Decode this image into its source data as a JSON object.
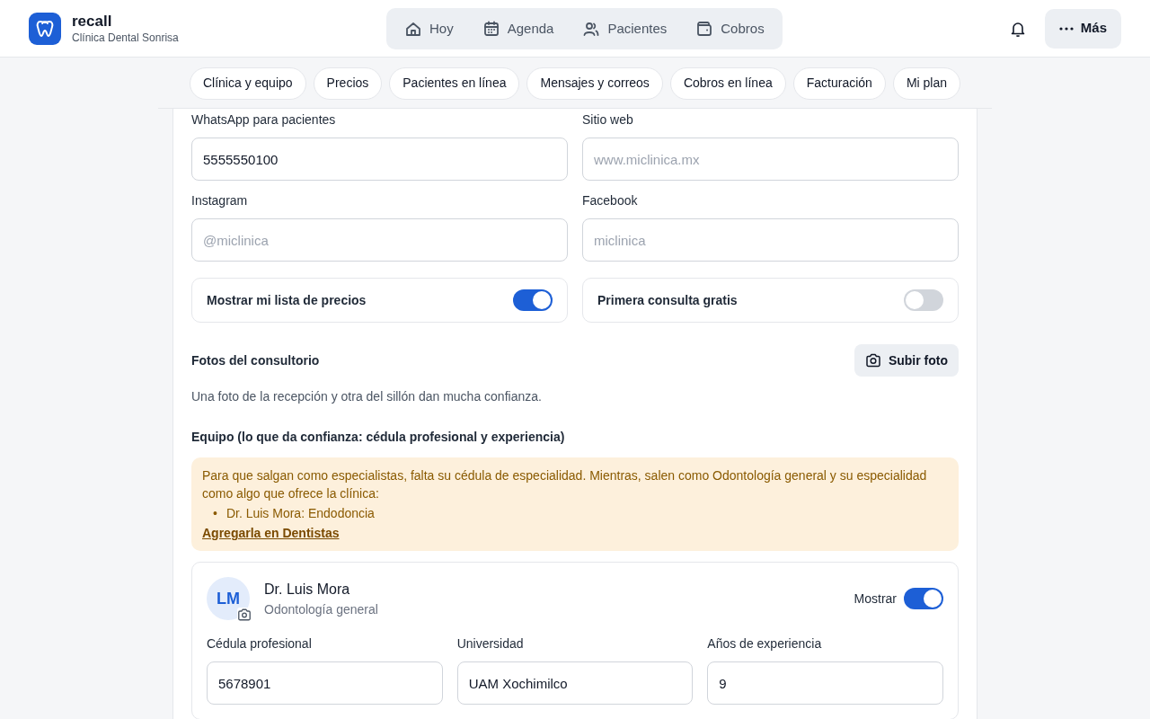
{
  "app": {
    "name": "recall",
    "clinic": "Clínica Dental Sonrisa"
  },
  "nav": [
    {
      "label": "Hoy",
      "selected": false
    },
    {
      "label": "Agenda",
      "selected": false
    },
    {
      "label": "Pacientes",
      "selected": false
    },
    {
      "label": "Cobros",
      "selected": false
    }
  ],
  "more_button": "Más",
  "settings_tabs": [
    {
      "label": "Clínica y equipo",
      "selected": false
    },
    {
      "label": "Precios",
      "selected": false
    },
    {
      "label": "Pacientes en línea",
      "selected": false
    },
    {
      "label": "Mensajes y correos",
      "selected": false
    },
    {
      "label": "Cobros en línea",
      "selected": false
    },
    {
      "label": "Facturación",
      "selected": false
    },
    {
      "label": "Mi plan",
      "selected": false
    }
  ],
  "fields": [
    {
      "label": "WhatsApp para pacientes",
      "value": "5555550100"
    },
    {
      "label": "Sitio web",
      "placeholder": "www.miclinica.mx"
    },
    {
      "label": "Instagram",
      "placeholder": "@miclinica"
    },
    {
      "label": "Facebook",
      "placeholder": "miclinica"
    }
  ],
  "toggles": [
    {
      "label": "Mostrar mi lista de precios",
      "on": true
    },
    {
      "label": "Primera consulta gratis",
      "on": false
    }
  ],
  "photos": {
    "title": "Fotos del consultorio",
    "upload_button": "Subir foto",
    "hint": "Una foto de la recepción y otra del sillón dan mucha confianza."
  },
  "team": {
    "title": "Equipo (lo que da confianza: cédula profesional y experiencia)",
    "alert": {
      "text": "Para que salgan como especialistas, falta su cédula de especialidad. Mientras, salen como Odontología general y su especialidad como algo que ofrece la clínica:",
      "items": [
        {
          "marker": "•",
          "text": "Dr. Luis Mora: Endodoncia"
        }
      ],
      "link": "Agregarla en Dentistas"
    },
    "dentists": [
      {
        "initials": "LM",
        "name": "Dr. Luis Mora",
        "specialty": "Odontología general",
        "show_label": "Mostrar",
        "show": true,
        "fields": [
          {
            "label": "Cédula profesional",
            "value": "5678901"
          },
          {
            "label": "Universidad",
            "value": "UAM Xochimilco"
          },
          {
            "label": "Años de experiencia",
            "value": "9"
          }
        ]
      }
    ]
  }
}
